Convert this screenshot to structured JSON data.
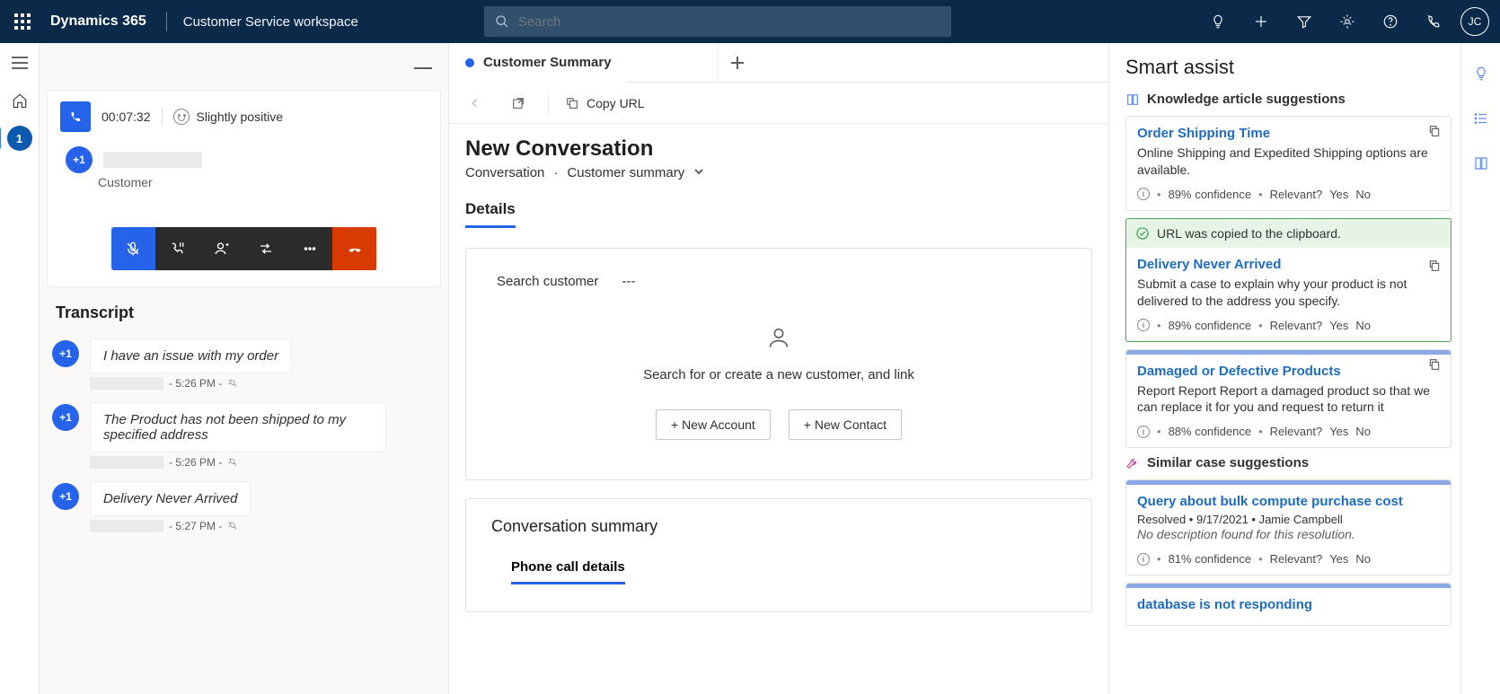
{
  "topnav": {
    "brand": "Dynamics 365",
    "workspace": "Customer Service workspace",
    "search_placeholder": "Search",
    "avatar_initials": "JC"
  },
  "leftrail": {
    "session_badge": "1"
  },
  "conversation": {
    "timer": "00:07:32",
    "sentiment": "Slightly positive",
    "customer_avatar": "+1",
    "customer_label": "Customer",
    "transcript_heading": "Transcript",
    "messages": [
      {
        "avatar": "+1",
        "text": "I have an issue with my order",
        "time": "- 5:26 PM  -"
      },
      {
        "avatar": "+1",
        "text": "The Product has not been shipped to my specified address",
        "time": "- 5:26 PM  -"
      },
      {
        "avatar": "+1",
        "text": "Delivery Never Arrived",
        "time": "- 5:27 PM  -"
      }
    ]
  },
  "center": {
    "tab_label": "Customer Summary",
    "copy_url": "Copy URL",
    "page_title": "New Conversation",
    "breadcrumb_a": "Conversation",
    "breadcrumb_b": "Customer summary",
    "section_tab": "Details",
    "search_customer_label": "Search customer",
    "search_customer_value": "---",
    "empty_text": "Search for or create a new customer, and link",
    "new_account": "+ New Account",
    "new_contact": "+ New Contact",
    "summary_heading": "Conversation summary",
    "summary_tab": "Phone call details"
  },
  "smart": {
    "heading": "Smart assist",
    "ka_heading": "Knowledge article suggestions",
    "toast": "URL was copied to the clipboard.",
    "articles": [
      {
        "title": "Order Shipping Time",
        "desc": "Online Shipping and Expedited Shipping options are available.",
        "conf": "89% confidence",
        "rel": "Relevant?",
        "yes": "Yes",
        "no": "No"
      },
      {
        "title": "Delivery Never Arrived",
        "desc": "Submit a case to explain why your product is not delivered to the address you specify.",
        "conf": "89% confidence",
        "rel": "Relevant?",
        "yes": "Yes",
        "no": "No"
      },
      {
        "title": "Damaged or Defective Products",
        "desc": "Report Report Report a damaged product so that we can replace it for you and request to return it",
        "conf": "88% confidence",
        "rel": "Relevant?",
        "yes": "Yes",
        "no": "No"
      }
    ],
    "similar_heading": "Similar case suggestions",
    "cases": [
      {
        "title": "Query about bulk compute purchase cost",
        "sub": "Resolved • 9/17/2021 • Jamie Campbell",
        "desc": "No description found for this resolution.",
        "conf": "81% confidence",
        "rel": "Relevant?",
        "yes": "Yes",
        "no": "No"
      },
      {
        "title": "database is not responding",
        "sub": "",
        "desc": "",
        "conf": "",
        "rel": "",
        "yes": "",
        "no": ""
      }
    ]
  }
}
